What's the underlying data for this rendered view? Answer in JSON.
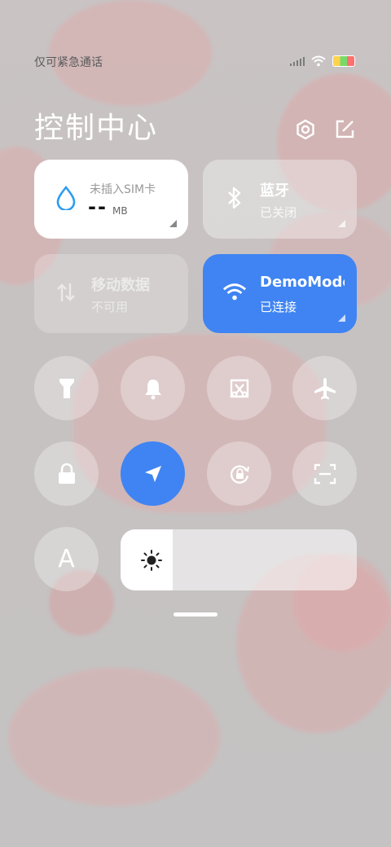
{
  "status_bar": {
    "carrier_text": "仅可紧急通话"
  },
  "header": {
    "title": "控制中心",
    "icons": [
      "settings-icon",
      "edit-icon"
    ]
  },
  "tiles": {
    "sim": {
      "label": "未插入SIM卡",
      "value": "--",
      "unit": "MB",
      "icon": "droplet-icon"
    },
    "bluetooth": {
      "label": "蓝牙",
      "status": "已关闭",
      "icon": "bluetooth-icon"
    },
    "mobile_data": {
      "label": "移动数据",
      "status": "不可用",
      "icon": "mobile-data-icon"
    },
    "wifi": {
      "label": "DemoMode",
      "status": "已连接",
      "icon": "wifi-icon"
    }
  },
  "toggles": [
    {
      "name": "flashlight",
      "icon": "flashlight-icon",
      "active": false
    },
    {
      "name": "silent",
      "icon": "bell-icon",
      "active": false
    },
    {
      "name": "screenshot",
      "icon": "screenshot-icon",
      "active": false
    },
    {
      "name": "airplane",
      "icon": "airplane-icon",
      "active": false
    },
    {
      "name": "lock",
      "icon": "lock-icon",
      "active": true
    },
    {
      "name": "location",
      "icon": "location-icon",
      "active": true
    },
    {
      "name": "rotation-lock",
      "icon": "rotation-lock-icon",
      "active": false
    },
    {
      "name": "scan",
      "icon": "scan-icon",
      "active": false
    },
    {
      "name": "font-size",
      "icon": "font-icon",
      "label": "A",
      "active": false
    }
  ],
  "brightness": {
    "level": 0.22,
    "icon": "sun-icon"
  },
  "colors": {
    "accent": "#3f84f2",
    "tile_white": "#ffffff"
  }
}
